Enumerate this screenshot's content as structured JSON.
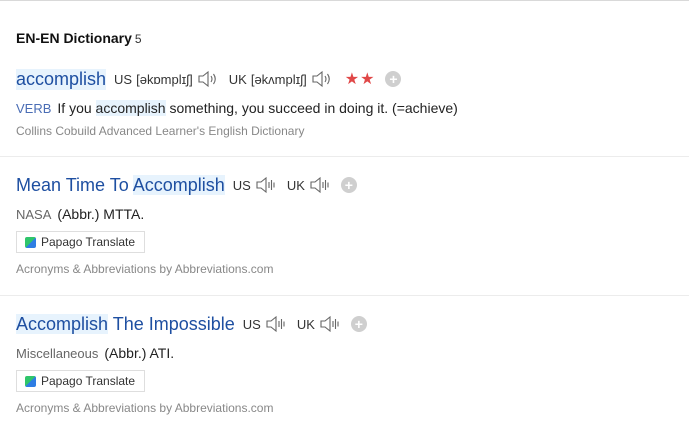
{
  "section": {
    "title": "EN-EN Dictionary",
    "count": "5"
  },
  "entries": [
    {
      "headword": "accomplish",
      "us_label": "US",
      "us_pron": "[əkɒmplɪʃ]",
      "uk_label": "UK",
      "uk_pron": "[əkʌmplɪʃ]",
      "stars": "★★",
      "pos": "VERB",
      "meaning_pre": "If you ",
      "meaning_hl": "accomplish",
      "meaning_post": " something, you succeed in doing it. (=achieve)",
      "source": "Collins Cobuild Advanced Learner's English Dictionary"
    },
    {
      "headword_pre": "Mean Time To ",
      "headword_hl": "Accomplish",
      "us_label": "US",
      "uk_label": "UK",
      "tag": "NASA",
      "meaning": "(Abbr.) MTTA.",
      "button": "Papago Translate",
      "source": "Acronyms & Abbreviations by Abbreviations.com"
    },
    {
      "headword_hl": "Accomplish",
      "headword_post": " The Impossible",
      "us_label": "US",
      "uk_label": "UK",
      "tag": "Miscellaneous",
      "meaning": "(Abbr.) ATI.",
      "button": "Papago Translate",
      "source": "Acronyms & Abbreviations by Abbreviations.com"
    }
  ],
  "colors": {
    "link": "#1e4fa1",
    "highlight": "#e7f3fd",
    "star": "#e04747"
  },
  "icons": {
    "speaker_active": "speaker-wave-icon",
    "speaker_muted": "speaker-bars-icon",
    "add": "plus-circle-icon",
    "papago": "papago-logo-icon"
  }
}
